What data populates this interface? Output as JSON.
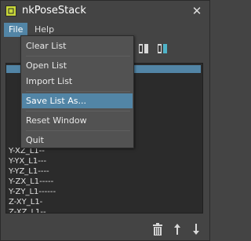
{
  "window": {
    "title": "nkPoseStack",
    "close_glyph": "✕"
  },
  "menubar": {
    "file": "File",
    "help": "Help"
  },
  "file_menu": {
    "clear_list": "Clear List",
    "open_list": "Open List",
    "import_list": "Import List",
    "save_list_as": "Save List As...",
    "reset_window": "Reset Window",
    "quit": "Quit",
    "highlighted_item": "save_list_as"
  },
  "pose_list": {
    "rows": [
      "Y-XZ_L1--",
      "Y-YX_L1---",
      "Y-YZ_L1----",
      "Y-ZX_L1-----",
      "Y-ZY_L1------",
      "Z-XY_L1-",
      "Z-XZ_L1--"
    ]
  },
  "icons": {
    "app": "app-logo-icon",
    "toolbar": [
      "layout-icon",
      "layout-color-icon"
    ],
    "bottom": [
      "trash-icon",
      "move-up-icon",
      "move-down-icon"
    ]
  },
  "colors": {
    "background": "#444444",
    "list_background": "#2b2b2b",
    "highlight": "#5285a6",
    "menu_background": "#525252"
  }
}
